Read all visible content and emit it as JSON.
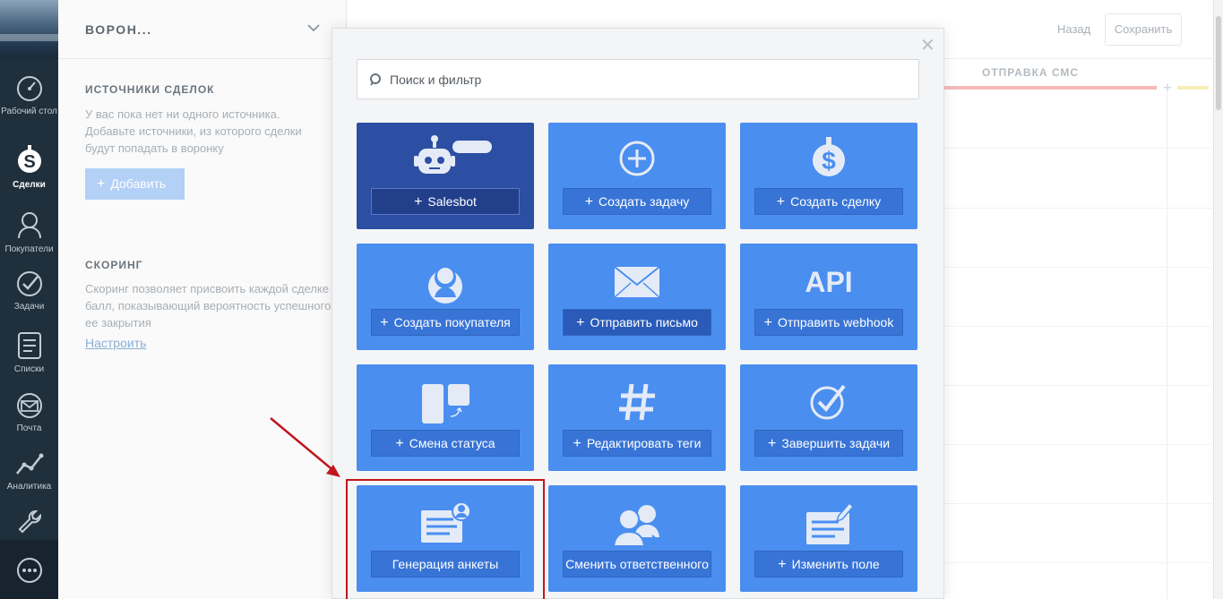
{
  "nav": {
    "items": [
      {
        "label": "Рабочий стол",
        "icon": "dashboard-icon"
      },
      {
        "label": "Сделки",
        "icon": "deals-icon"
      },
      {
        "label": "Покупатели",
        "icon": "customers-icon"
      },
      {
        "label": "Задачи",
        "icon": "tasks-icon"
      },
      {
        "label": "Списки",
        "icon": "lists-icon"
      },
      {
        "label": "Почта",
        "icon": "mail-icon"
      },
      {
        "label": "Аналитика",
        "icon": "analytics-icon"
      }
    ],
    "active": "Сделки"
  },
  "panel": {
    "title": "ВОРОН...",
    "sources": {
      "title": "ИСТОЧНИКИ СДЕЛОК",
      "text": "У вас пока нет ни одного источника. Добавьте источники, из которого сделки будут попадать в воронку",
      "add_label": "Добавить"
    },
    "scoring": {
      "title": "СКОРИНГ",
      "text": "Скоринг позволяет присвоить каждой сделке балл, показывающий вероятность успешного ее закрытия",
      "link": "Настроить"
    }
  },
  "header": {
    "back_label": "Назад",
    "save_label": "Сохранить"
  },
  "pipeline": {
    "stage": "ОТПРАВКА СМС"
  },
  "modal": {
    "search_placeholder": "Поиск и фильтр",
    "tiles": [
      {
        "label": "Salesbot",
        "plus": true,
        "icon": "salesbot-icon",
        "dark": true
      },
      {
        "label": "Создать задачу",
        "plus": true,
        "icon": "add-task-icon"
      },
      {
        "label": "Создать сделку",
        "plus": true,
        "icon": "dollar-icon"
      },
      {
        "label": "Создать покупателя",
        "plus": true,
        "icon": "customer-icon"
      },
      {
        "label": "Отправить письмо",
        "plus": true,
        "icon": "envelope-icon"
      },
      {
        "label": "Отправить webhook",
        "plus": true,
        "icon": "api-icon",
        "icon_text": "API"
      },
      {
        "label": "Смена статуса",
        "plus": true,
        "icon": "status-change-icon"
      },
      {
        "label": "Редактировать теги",
        "plus": true,
        "icon": "hashtag-icon"
      },
      {
        "label": "Завершить задачи",
        "plus": true,
        "icon": "check-circle-icon"
      },
      {
        "label": "Генерация анкеты",
        "plus": false,
        "icon": "form-generation-icon"
      },
      {
        "label": "Сменить ответственного",
        "plus": false,
        "icon": "change-responsible-icon"
      },
      {
        "label": "Изменить поле",
        "plus": true,
        "icon": "edit-field-icon"
      }
    ]
  },
  "colors": {
    "tile": "#4a8ef0",
    "tile_dark": "#2c4ea3",
    "highlight": "#c0161c",
    "nav_bg": "#1f2f3c"
  }
}
